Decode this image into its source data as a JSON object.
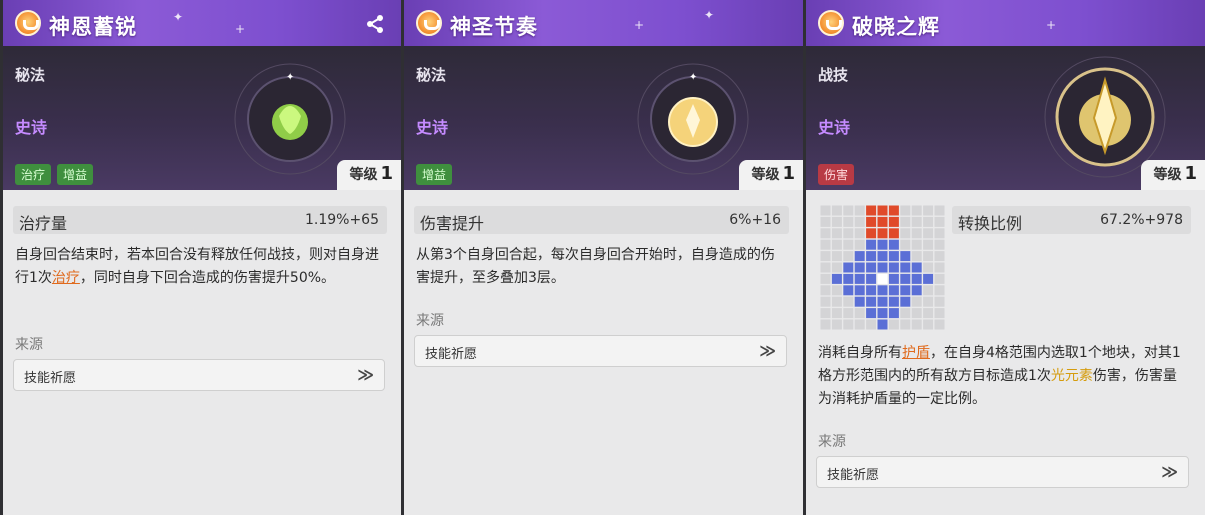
{
  "cards": [
    {
      "name": "神恩蓄锐",
      "type": "秘法",
      "rarity": "史诗",
      "tags": [
        "治疗",
        "增益"
      ],
      "level_label": "等级",
      "level_value": "1",
      "stat_label": "治疗量",
      "stat_value": "1.19%+65",
      "desc_parts": [
        "自身回合结束时，若本回合没有释放任何战技，则对自身进行1次",
        "治疗",
        "，同时自身下回合造成的伤害提升50%。"
      ],
      "source_label": "来源",
      "source_button": "技能祈愿",
      "arrow": "≫",
      "orb_color": "#9be04a"
    },
    {
      "name": "神圣节奏",
      "type": "秘法",
      "rarity": "史诗",
      "tags": [
        "增益"
      ],
      "level_label": "等级",
      "level_value": "1",
      "stat_label": "伤害提升",
      "stat_value": "6%+16",
      "desc_parts": [
        "从第3个自身回合起，每次自身回合开始时，自身造成的伤害提升，至多叠加3层。"
      ],
      "source_label": "来源",
      "source_button": "技能祈愿",
      "arrow": "≫",
      "orb_color": "#f5d37a"
    },
    {
      "name": "破晓之辉",
      "type": "战技",
      "rarity": "史诗",
      "tags": [
        "伤害"
      ],
      "level_label": "等级",
      "level_value": "1",
      "stat_label": "转换比例",
      "stat_value": "67.2%+978",
      "desc_parts": [
        "消耗自身所有",
        "护盾",
        "，在自身4格范围内选取1个地块，对其1格方形范围内的所有敌方目标造成1次",
        "光元素",
        "伤害，伤害量为消耗护盾量的一定比例。"
      ],
      "source_label": "来源",
      "source_button": "技能祈愿",
      "arrow": "≫",
      "orb_color": "#ffe27a"
    }
  ],
  "colors": {
    "header": "#7d4fcf",
    "rarity": "#c58bff",
    "grid_red": "#e04a2a",
    "grid_blue": "#5b6fd6",
    "grid_empty": "#d4d4d6"
  }
}
